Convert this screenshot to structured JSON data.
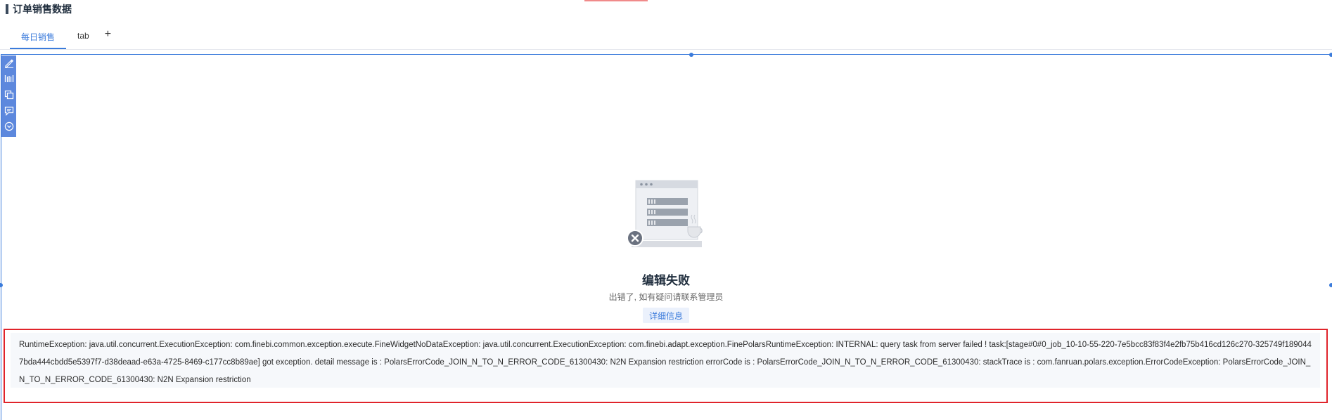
{
  "page": {
    "title": "订单销售数据"
  },
  "tabs": [
    {
      "label": "每日销售",
      "active": true
    },
    {
      "label": "tab",
      "active": false
    }
  ],
  "add_tab_label": "+",
  "toolbar": {
    "tools": [
      "edit-icon",
      "chart-icon",
      "copy-icon",
      "comment-icon",
      "more-icon"
    ]
  },
  "error_state": {
    "title": "编辑失败",
    "subtitle": "出错了, 如有疑问请联系管理员",
    "detail_button": "详细信息",
    "message": "RuntimeException: java.util.concurrent.ExecutionException: com.finebi.common.exception.execute.FineWidgetNoDataException: java.util.concurrent.ExecutionException: com.finebi.adapt.exception.FinePolarsRuntimeException: INTERNAL: query task from server failed ! task:[stage#0#0_job_10-10-55-220-7e5bcc83f83f4e2fb75b416cd126c270-325749f1890447bda444cbdd5e5397f7-d38deaad-e63a-4725-8469-c177cc8b89ae] got exception. detail message is : PolarsErrorCode_JOIN_N_TO_N_ERROR_CODE_61300430: N2N Expansion restriction errorCode is : PolarsErrorCode_JOIN_N_TO_N_ERROR_CODE_61300430:  stackTrace is : com.fanruan.polars.exception.ErrorCodeException: PolarsErrorCode_JOIN_N_TO_N_ERROR_CODE_61300430: N2N Expansion restriction"
  },
  "colors": {
    "accent": "#3b7bdb",
    "toolbar": "#5d88dd",
    "error_border": "#e0242b"
  }
}
